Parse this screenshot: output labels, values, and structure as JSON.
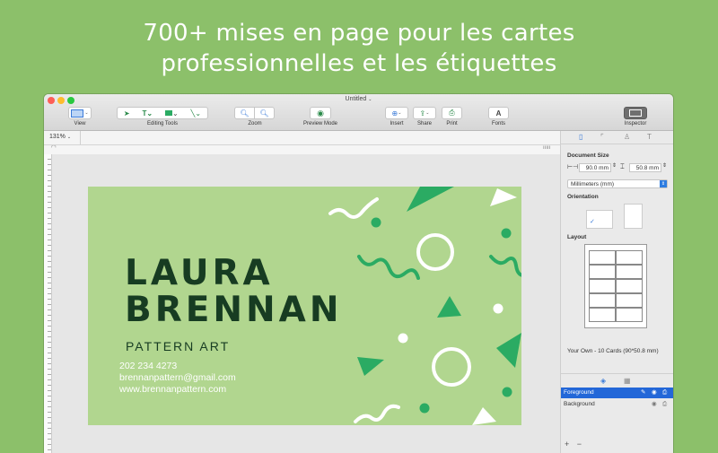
{
  "headline": {
    "line1": "700+ mises en page pour les cartes",
    "line2": "professionnelles et les étiquettes"
  },
  "window": {
    "title": "Untitled",
    "traffic_colors": [
      "#fd5f57",
      "#fdbc2e",
      "#29c840"
    ]
  },
  "toolbar": {
    "view_label": "View",
    "editing_tools_label": "Editing Tools",
    "zoom_label": "Zoom",
    "preview_label": "Preview Mode",
    "insert_label": "Insert",
    "share_label": "Share",
    "print_label": "Print",
    "fonts_label": "Fonts",
    "inspector_label": "Inspector"
  },
  "zoom_level": "131%",
  "card": {
    "name_line1": "LAURA",
    "name_line2": "BRENNAN",
    "tagline": "PATTERN ART",
    "phone": "202 234 4273",
    "email": "brennanpattern@gmail.com",
    "website": "www.brennanpattern.com",
    "bg_color": "#b1d68f",
    "text_color": "#173c22",
    "accent_color": "#2bab63"
  },
  "inspector": {
    "doc_size_label": "Document Size",
    "width_value": "90.0 mm",
    "height_value": "50.8 mm",
    "units_value": "Millimeters (mm)",
    "orientation_label": "Orientation",
    "layout_label": "Layout",
    "layout_desc": "Your Own - 10 Cards (90*50.8 mm)",
    "layers": [
      {
        "name": "Foreground",
        "selected": true
      },
      {
        "name": "Background",
        "selected": false
      }
    ],
    "select_color": "#2367d8"
  }
}
